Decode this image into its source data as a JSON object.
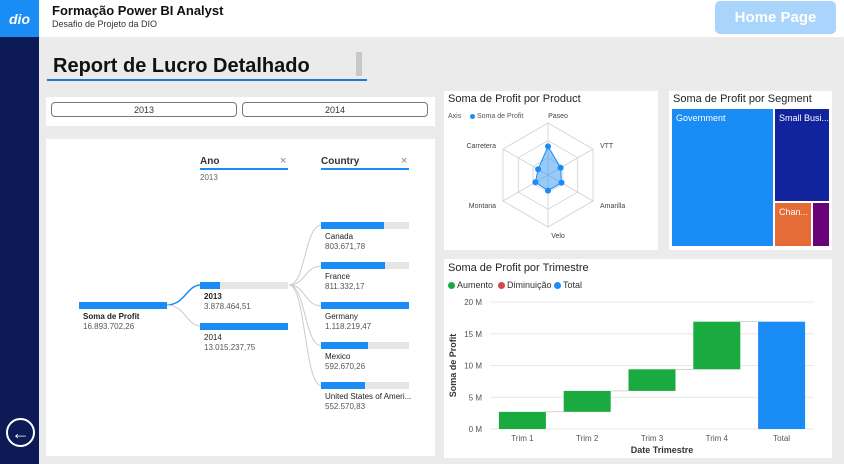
{
  "app": {
    "title": "Formação Power BI Analyst",
    "subtitle": "Desafio de Projeto da DIO",
    "logo": "dio",
    "home_button": "Home Page"
  },
  "report": {
    "title": "Report de Lucro Detalhado"
  },
  "slicer": {
    "options": [
      "2013",
      "2014"
    ]
  },
  "decomp": {
    "col1": {
      "header": "Ano",
      "selected": "2013"
    },
    "col2": {
      "header": "Country"
    },
    "root": {
      "label": "Soma de Profit",
      "value": "16.893.702,26"
    },
    "years": [
      {
        "label": "2013",
        "value": "3.878.464,51",
        "fill": 0.23
      },
      {
        "label": "2014",
        "value": "13.015.237,75",
        "fill": 1
      }
    ],
    "countries": [
      {
        "label": "Canada",
        "value": "803.671,78",
        "fill": 0.72
      },
      {
        "label": "France",
        "value": "811.332,17",
        "fill": 0.73
      },
      {
        "label": "Germany",
        "value": "1.118.219,47",
        "fill": 1
      },
      {
        "label": "Mexico",
        "value": "592.670,26",
        "fill": 0.53
      },
      {
        "label": "United States of Ameri...",
        "value": "552.570,83",
        "fill": 0.5
      }
    ]
  },
  "radar": {
    "title": "Soma de Profit por Product",
    "legend_axis": "Axis",
    "legend_series": "Soma de Profit",
    "axes": [
      "Paseo",
      "VTT",
      "Amarilla",
      "Velo",
      "Montana",
      "Carretera"
    ],
    "values": [
      0.55,
      0.28,
      0.3,
      0.3,
      0.28,
      0.22
    ],
    "color": "#1a8cf5"
  },
  "treemap": {
    "title": "Soma de Profit por Segment",
    "items": [
      {
        "label": "Government",
        "color": "#1a8cf5"
      },
      {
        "label": "Small Busi...",
        "color": "#12239e"
      },
      {
        "label": "Chan...",
        "color": "#e66c37"
      },
      {
        "label": "",
        "color": "#6b007b"
      }
    ]
  },
  "chart_data": {
    "type": "bar",
    "subtype": "waterfall",
    "title": "Soma de Profit por Trimestre",
    "xlabel": "Date Trimestre",
    "ylabel": "Soma de Profit",
    "legend": [
      {
        "name": "Aumento",
        "color": "#1aab40"
      },
      {
        "name": "Diminuição",
        "color": "#d64550"
      },
      {
        "name": "Total",
        "color": "#1a8cf5"
      }
    ],
    "categories": [
      "Trim 1",
      "Trim 2",
      "Trim 3",
      "Trim 4",
      "Total"
    ],
    "values": [
      2.7,
      3.3,
      3.4,
      7.5,
      16.9
    ],
    "yticks": [
      "0 M",
      "5 M",
      "10 M",
      "15 M",
      "20 M"
    ],
    "ylim": [
      0,
      20
    ]
  }
}
